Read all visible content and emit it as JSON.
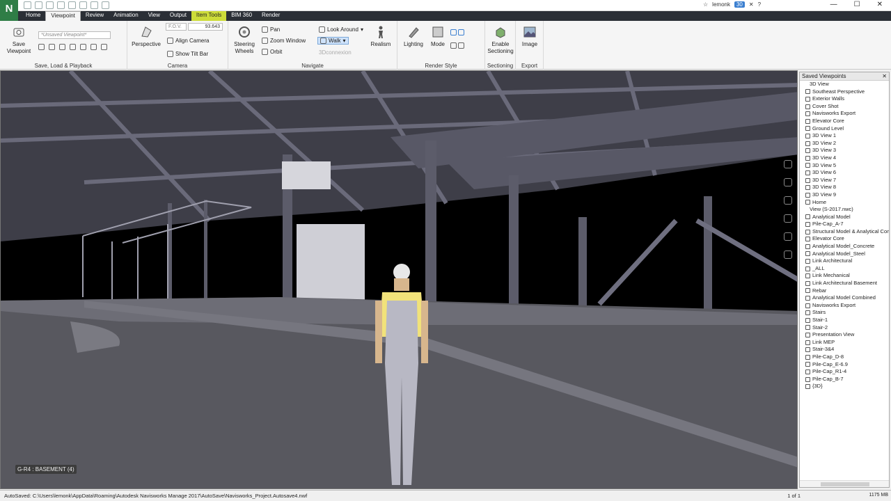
{
  "app": {
    "logo": "N",
    "user": "lemonk",
    "badge": "30"
  },
  "tabs": [
    "Home",
    "Viewpoint",
    "Review",
    "Animation",
    "View",
    "Output",
    "Item Tools",
    "BIM 360",
    "Render"
  ],
  "ribbon": {
    "save_viewpoint": "Save Viewpoint",
    "viewpoint_combo": "*Unsaved Viewpoint*",
    "panel_save": "Save, Load & Playback",
    "perspective": "Perspective",
    "fov_label": "F.O.V.",
    "fov_value": "93.643",
    "align_camera": "Align Camera",
    "show_tilt_bar": "Show Tilt Bar",
    "panel_camera": "Camera",
    "steering_wheels": "Steering Wheels",
    "pan": "Pan",
    "zoom_window": "Zoom Window",
    "orbit": "Orbit",
    "look_around": "Look Around",
    "walk": "Walk",
    "connexion": "3Dconnexion",
    "realism": "Realism",
    "panel_navigate": "Navigate",
    "lighting": "Lighting",
    "mode": "Mode",
    "panel_render_style": "Render Style",
    "enable_sectioning": "Enable Sectioning",
    "panel_sectioning": "Sectioning",
    "image": "Image",
    "panel_export": "Export"
  },
  "viewport": {
    "level_label": "G-R4 : BASEMENT (4)"
  },
  "saved_viewpoints": {
    "title": "Saved Viewpoints",
    "items": [
      {
        "label": "3D View",
        "folder": true
      },
      {
        "label": "Southeast Perspective"
      },
      {
        "label": "Exterior Walls"
      },
      {
        "label": "Cover Shot"
      },
      {
        "label": "Navisworks Export"
      },
      {
        "label": "Elevator Core"
      },
      {
        "label": "Ground Level"
      },
      {
        "label": "3D View 1"
      },
      {
        "label": "3D View 2"
      },
      {
        "label": "3D View 3"
      },
      {
        "label": "3D View 4"
      },
      {
        "label": "3D View 5"
      },
      {
        "label": "3D View 6"
      },
      {
        "label": "3D View 7"
      },
      {
        "label": "3D View 8"
      },
      {
        "label": "3D View 9"
      },
      {
        "label": "Home"
      },
      {
        "label": "View (S-2017.nwc)",
        "folder": true
      },
      {
        "label": "Analytical Model"
      },
      {
        "label": "Pile-Cap_A-7"
      },
      {
        "label": "Structural Model & Analytical Combi"
      },
      {
        "label": "Elevator Core"
      },
      {
        "label": "Analytical Model_Concrete"
      },
      {
        "label": "Analytical Model_Steel"
      },
      {
        "label": "Link Architectural"
      },
      {
        "label": "_ALL"
      },
      {
        "label": "Link Mechanical"
      },
      {
        "label": "Link Architectural Basement"
      },
      {
        "label": "Rebar"
      },
      {
        "label": "Analytical Model Combined"
      },
      {
        "label": "Navisworks Export"
      },
      {
        "label": "Stairs"
      },
      {
        "label": "Stair-1"
      },
      {
        "label": "Stair-2"
      },
      {
        "label": "Presentation View"
      },
      {
        "label": "Link MEP"
      },
      {
        "label": "Stair-3&4"
      },
      {
        "label": "Pile-Cap_D-8"
      },
      {
        "label": "Pile-Cap_E-6.9"
      },
      {
        "label": "Pile-Cap_R1-4"
      },
      {
        "label": "Pile-Cap_B-7"
      },
      {
        "label": "{3D}"
      }
    ]
  },
  "status": {
    "path": "AutoSaved: C:\\Users\\lemonk\\AppData\\Roaming\\Autodesk Navisworks Manage 2017\\AutoSave\\Navisworks_Project.Autosave4.nwf",
    "page": "1 of 1",
    "memory": "1175 MB"
  }
}
